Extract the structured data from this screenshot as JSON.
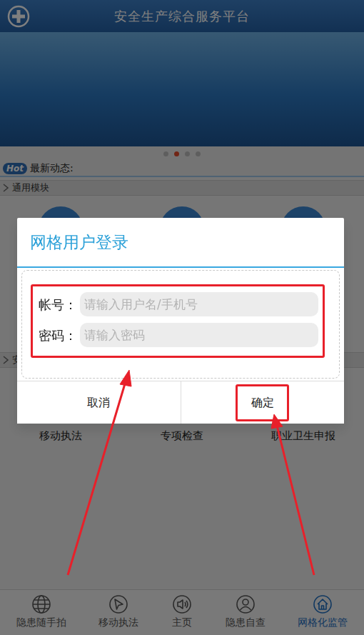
{
  "header": {
    "title": "安全生产综合服务平台"
  },
  "banner": {
    "dots": [
      {
        "selected": false
      },
      {
        "selected": true
      },
      {
        "selected": false
      },
      {
        "selected": false
      }
    ]
  },
  "news": {
    "badge": "Hot",
    "label": "最新动态:"
  },
  "sections": [
    {
      "title": "通用模块",
      "modules": []
    },
    {
      "title": "安",
      "modules": [
        {
          "label": "移动执法"
        },
        {
          "label": "专项检查"
        },
        {
          "label": "职业卫生申报"
        }
      ]
    }
  ],
  "tabbar": [
    {
      "label": "隐患随手拍",
      "selected": false
    },
    {
      "label": "移动执法",
      "selected": false
    },
    {
      "label": "主页",
      "selected": false
    },
    {
      "label": "隐患自查",
      "selected": false
    },
    {
      "label": "网格化监管",
      "selected": true
    }
  ],
  "dialog": {
    "title": "网格用户登录",
    "fields": [
      {
        "label": "帐号：",
        "placeholder": "请输入用户名/手机号"
      },
      {
        "label": "密码：",
        "placeholder": "请输入密码"
      }
    ],
    "buttons": [
      "取消",
      "确定"
    ]
  }
}
